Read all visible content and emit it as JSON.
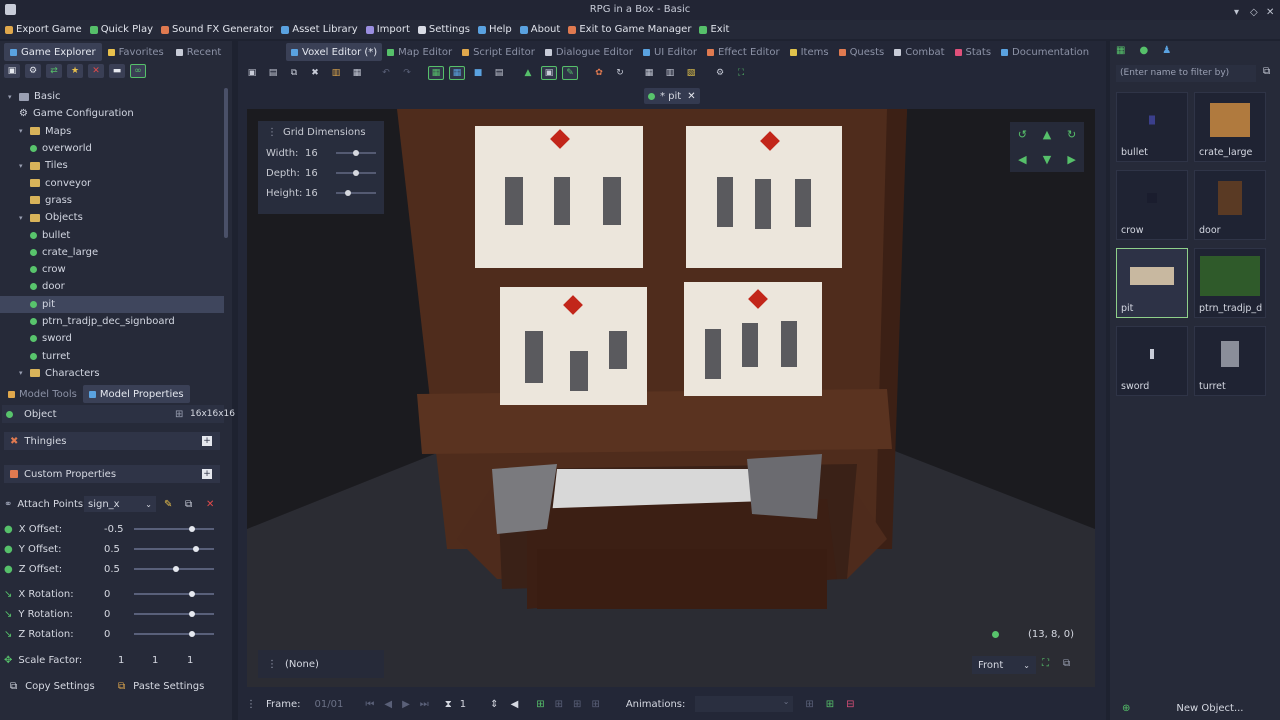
{
  "window": {
    "title": "RPG in a Box - Basic"
  },
  "menu": [
    {
      "label": "Export Game",
      "color": "#e0a84c"
    },
    {
      "label": "Quick Play",
      "color": "#56c06a"
    },
    {
      "label": "Sound FX Generator",
      "color": "#e07a50"
    },
    {
      "label": "Asset Library",
      "color": "#5aa2e0"
    },
    {
      "label": "Import",
      "color": "#9a8ee0"
    },
    {
      "label": "Settings",
      "color": "#d9dce5"
    },
    {
      "label": "Help",
      "color": "#5aa2e0"
    },
    {
      "label": "About",
      "color": "#5aa2e0"
    },
    {
      "label": "Exit to Game Manager",
      "color": "#e07a50"
    },
    {
      "label": "Exit",
      "color": "#56c06a"
    }
  ],
  "left_tabs": [
    {
      "label": "Game Explorer"
    },
    {
      "label": "Favorites"
    },
    {
      "label": "Recent"
    }
  ],
  "editor_tabs": [
    {
      "label": "Voxel Editor (*)",
      "color": "#5aa2e0"
    },
    {
      "label": "Map Editor",
      "color": "#56c06a"
    },
    {
      "label": "Script Editor",
      "color": "#e0a84c"
    },
    {
      "label": "Dialogue Editor",
      "color": "#c8ccd8"
    },
    {
      "label": "UI Editor",
      "color": "#5aa2e0"
    },
    {
      "label": "Effect Editor",
      "color": "#e07a50"
    },
    {
      "label": "Items",
      "color": "#e0c24c"
    },
    {
      "label": "Quests",
      "color": "#e07a50"
    },
    {
      "label": "Combat",
      "color": "#c8ccd8"
    },
    {
      "label": "Stats",
      "color": "#e0507a"
    },
    {
      "label": "Documentation",
      "color": "#5aa2e0"
    }
  ],
  "tree": [
    {
      "label": "Basic",
      "level": 0,
      "type": "root"
    },
    {
      "label": "Game Configuration",
      "level": 1,
      "type": "gear"
    },
    {
      "label": "Maps",
      "level": 1,
      "type": "folder"
    },
    {
      "label": "overworld",
      "level": 2,
      "type": "leaf"
    },
    {
      "label": "Tiles",
      "level": 1,
      "type": "folder"
    },
    {
      "label": "conveyor",
      "level": 2,
      "type": "folder"
    },
    {
      "label": "grass",
      "level": 2,
      "type": "folder"
    },
    {
      "label": "Objects",
      "level": 1,
      "type": "folder"
    },
    {
      "label": "bullet",
      "level": 2,
      "type": "leaf"
    },
    {
      "label": "crate_large",
      "level": 2,
      "type": "leaf"
    },
    {
      "label": "crow",
      "level": 2,
      "type": "leaf"
    },
    {
      "label": "door",
      "level": 2,
      "type": "leaf"
    },
    {
      "label": "pit",
      "level": 2,
      "type": "leaf",
      "selected": true
    },
    {
      "label": "ptrn_tradjp_dec_signboard",
      "level": 2,
      "type": "leaf"
    },
    {
      "label": "sword",
      "level": 2,
      "type": "leaf"
    },
    {
      "label": "turret",
      "level": 2,
      "type": "leaf"
    },
    {
      "label": "Characters",
      "level": 1,
      "type": "folder"
    }
  ],
  "props_tabs": [
    {
      "label": "Model Tools"
    },
    {
      "label": "Model Properties"
    }
  ],
  "props": {
    "object_label": "Object",
    "size": "16x16x16",
    "thingies": "Thingies",
    "custom": "Custom Properties",
    "attach_label": "Attach Points:",
    "attach_value": "sign_x",
    "offsets": [
      {
        "label": "X Offset:",
        "value": "-0.5",
        "level": 0.73
      },
      {
        "label": "Y Offset:",
        "value": "0.5",
        "level": 0.77
      },
      {
        "label": "Z Offset:",
        "value": "0.5",
        "level": 0.53
      }
    ],
    "rotations": [
      {
        "label": "X Rotation:",
        "value": "0",
        "level": 0.73
      },
      {
        "label": "Y Rotation:",
        "value": "0",
        "level": 0.73
      },
      {
        "label": "Z Rotation:",
        "value": "0",
        "level": 0.73
      }
    ],
    "scale_label": "Scale Factor:",
    "scale": [
      "1",
      "1",
      "1"
    ],
    "copy": "Copy Settings",
    "paste": "Paste Settings"
  },
  "file_tab": "* pit",
  "grid": {
    "title": "Grid Dimensions",
    "rows": [
      {
        "label": "Width:",
        "value": "16",
        "level": 0.5
      },
      {
        "label": "Depth:",
        "value": "16",
        "level": 0.5
      },
      {
        "label": "Height:",
        "value": "16",
        "level": 0.3
      }
    ]
  },
  "coords": "(13, 8, 0)",
  "bottom": {
    "none": "(None)",
    "view": "Front",
    "frame_label": "Frame:",
    "frame_value": "01/01",
    "step": "1",
    "animations": "Animations:"
  },
  "filter_placeholder": "(Enter name to filter by)",
  "assets": [
    {
      "name": "bullet"
    },
    {
      "name": "crate_large"
    },
    {
      "name": "crow"
    },
    {
      "name": "door"
    },
    {
      "name": "pit",
      "selected": true
    },
    {
      "name": "ptrn_tradjp_d"
    },
    {
      "name": "sword"
    },
    {
      "name": "turret"
    }
  ],
  "new_object": "New Object..."
}
